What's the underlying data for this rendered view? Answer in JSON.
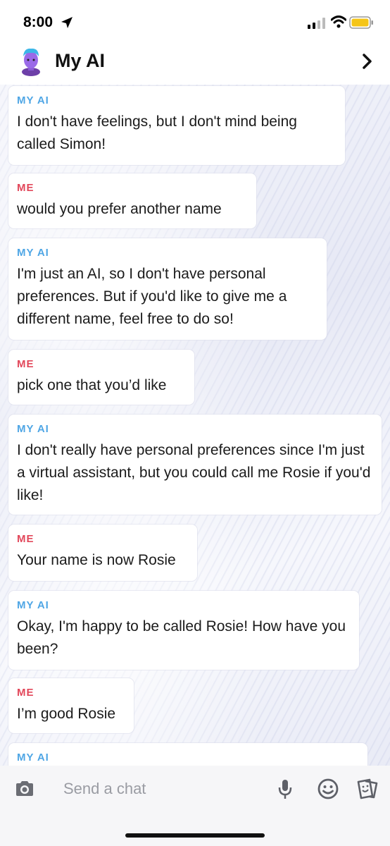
{
  "status_bar": {
    "time": "8:00"
  },
  "header": {
    "title": "My AI"
  },
  "messages": [
    {
      "sender": "MY AI",
      "text": "I don't have feelings, but I don't mind being called Simon!"
    },
    {
      "sender": "ME",
      "text": "would you prefer another name"
    },
    {
      "sender": "MY AI",
      "text": "I'm just an AI, so I don't have personal preferences. But if you'd like to give me a different name, feel free to do so!"
    },
    {
      "sender": "ME",
      "text": "pick one that you’d like"
    },
    {
      "sender": "MY AI",
      "text": "I don't really have personal preferences since I'm just a virtual assistant, but you could call me Rosie if you'd like!"
    },
    {
      "sender": "ME",
      "text": "Your name is now Rosie"
    },
    {
      "sender": "MY AI",
      "text": "Okay, I'm happy to be called Rosie! How have you been?"
    },
    {
      "sender": "ME",
      "text": "I’m good Rosie"
    },
    {
      "sender": "MY AI",
      "text": ""
    }
  ],
  "input": {
    "placeholder": "Send a chat"
  },
  "colors": {
    "ai_label": "#4fa6e5",
    "me_label": "#e2475a",
    "battery": "#f5c518"
  },
  "icons": [
    "location-arrow-icon",
    "signal-icon",
    "wifi-icon",
    "battery-icon",
    "avatar",
    "chevron-right-icon",
    "camera-icon",
    "microphone-icon",
    "smiley-icon",
    "sticker-icon"
  ]
}
